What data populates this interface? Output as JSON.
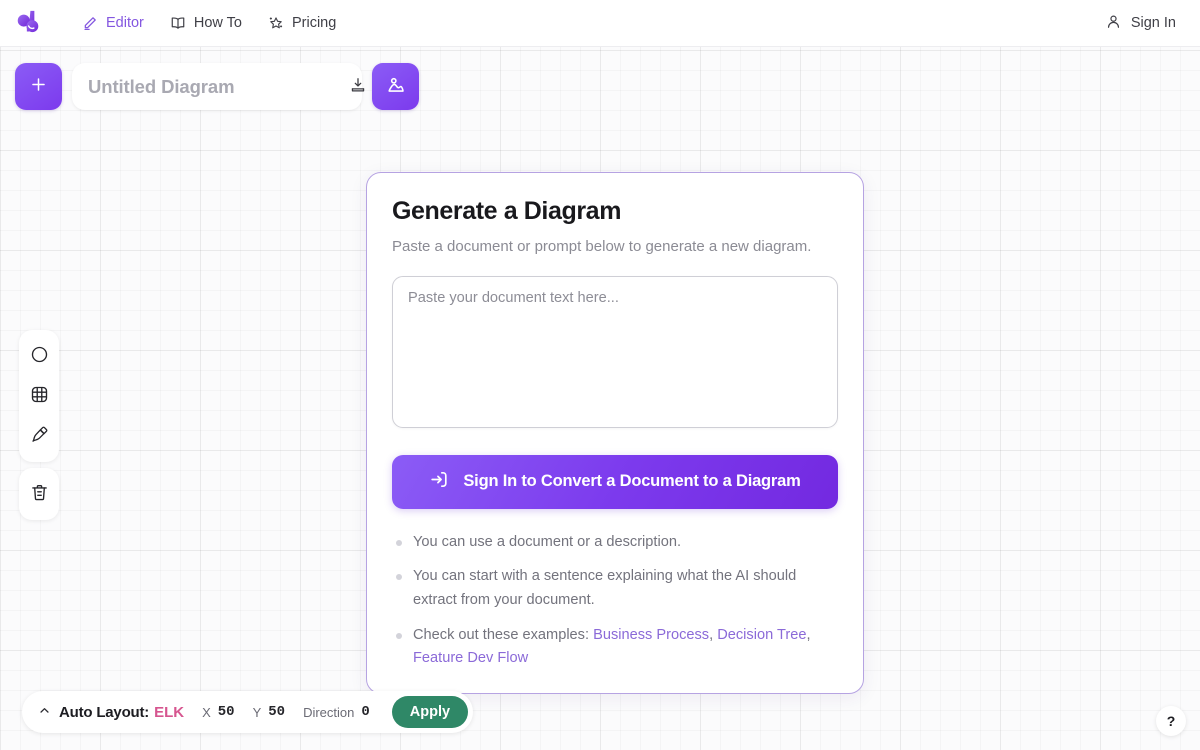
{
  "app": {
    "logo_icon": "diagramly-logo-icon"
  },
  "topnav": {
    "items": [
      {
        "label": "Editor",
        "icon": "pencil-icon",
        "active": true
      },
      {
        "label": "How To",
        "icon": "book-icon",
        "active": false
      },
      {
        "label": "Pricing",
        "icon": "sparkle-star-icon",
        "active": false
      }
    ],
    "signin": {
      "label": "Sign In",
      "icon": "user-icon"
    }
  },
  "doc_toolbar": {
    "add_label": "+",
    "add_icon": "plus-icon",
    "title_value": "",
    "title_placeholder": "Untitled Diagram",
    "download_icon": "download-icon",
    "open_icon": "folder-open-icon",
    "image_icon": "image-icon"
  },
  "tool_rail": {
    "groups": [
      {
        "tools": [
          {
            "name": "shape-circle-tool",
            "icon": "circle-icon"
          },
          {
            "name": "grid-tool",
            "icon": "grid-icon"
          },
          {
            "name": "paint-tool",
            "icon": "paint-brush-icon"
          }
        ]
      },
      {
        "tools": [
          {
            "name": "delete-tool",
            "icon": "trash-icon"
          }
        ]
      }
    ]
  },
  "generate_card": {
    "title": "Generate a Diagram",
    "subtitle": "Paste a document or prompt below to generate a new diagram.",
    "textarea_value": "",
    "textarea_placeholder": "Paste your document text here...",
    "cta_label": "Sign In to Convert a Document to a Diagram",
    "cta_icon": "sign-in-arrow-icon",
    "hints": [
      {
        "text": "You can use a document or a description."
      },
      {
        "text": "You can start with a sentence explaining what the AI should extract from your document."
      }
    ],
    "examples_prefix": "Check out these examples:",
    "examples": [
      {
        "label": "Business Process"
      },
      {
        "label": "Decision Tree"
      },
      {
        "label": "Feature Dev Flow"
      }
    ],
    "examples_sep1": ",",
    "examples_sep2": ","
  },
  "layout_bar": {
    "collapse_icon": "chevron-up-icon",
    "label": "Auto Layout:",
    "engine": "ELK",
    "x_label": "X",
    "x_value": "50",
    "y_label": "Y",
    "y_value": "50",
    "direction_label": "Direction",
    "direction_value": "0",
    "apply_label": "Apply"
  },
  "help": {
    "label": "?",
    "icon": "question-mark-icon"
  },
  "colors": {
    "accent_purple": "#7c3aed",
    "card_border": "#b6a3e2",
    "engine_pink": "#d6558f",
    "apply_green": "#2f8867",
    "link_purple": "#8b6ad8"
  }
}
